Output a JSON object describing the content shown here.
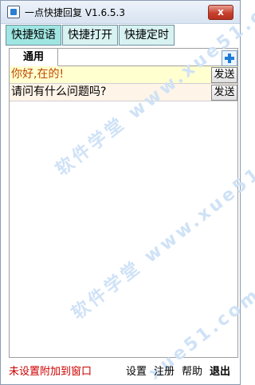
{
  "window": {
    "title": "一点快捷回复 V1.6.5.3",
    "close_label": "x"
  },
  "tabs": [
    {
      "label": "快捷短语",
      "active": true
    },
    {
      "label": "快捷打开",
      "active": false
    },
    {
      "label": "快捷定时",
      "active": false
    }
  ],
  "subtab": {
    "label": "通用"
  },
  "phrases": [
    {
      "text": "你好,在的!",
      "button": "发送"
    },
    {
      "text": "请问有什么问题吗?",
      "button": "发送"
    }
  ],
  "watermarks": [
    "软件学堂 www.xue51.com",
    "软件学堂 www.xue51.com",
    "xue51.com"
  ],
  "footer": {
    "status": "未设置附加到窗口",
    "settings": "设置",
    "register": "注册",
    "help": "帮助",
    "exit": "退出"
  },
  "colors": {
    "tab_bg": "#d8f2f2",
    "tab_active_bg": "#9fe6e2",
    "row1_bg": "#ffffd0",
    "row1_text": "#c04a00",
    "status_text": "#cc0000"
  },
  "icons": {
    "app": "app-icon",
    "add": "plus-icon"
  }
}
